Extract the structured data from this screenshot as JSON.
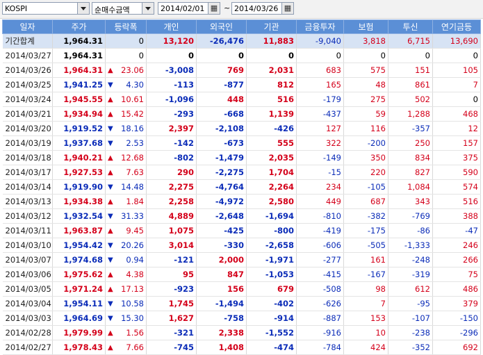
{
  "toolbar": {
    "market": "KOSPI",
    "metric": "순매수금액",
    "start_date": "2014/02/01",
    "separator": "~",
    "end_date": "2014/03/26",
    "calendar_glyph": "▦"
  },
  "columns": [
    "일자",
    "주가",
    "등락폭",
    "개인",
    "외국인",
    "기관",
    "금융투자",
    "보험",
    "투신",
    "연기금등"
  ],
  "rows": [
    {
      "date": "기간합계",
      "price": "1,964.31",
      "dir": "",
      "change": "0",
      "indiv": "13,120",
      "foreign": "-26,476",
      "inst": "11,883",
      "fin": "-9,040",
      "ins": "3,818",
      "trust": "6,715",
      "pension": "13,690",
      "total": true
    },
    {
      "date": "2014/03/27",
      "price": "1,964.31",
      "dir": "",
      "change": "0",
      "indiv": "0",
      "foreign": "0",
      "inst": "0",
      "fin": "0",
      "ins": "0",
      "trust": "0",
      "pension": "0"
    },
    {
      "date": "2014/03/26",
      "price": "1,964.31",
      "dir": "up",
      "change": "23.06",
      "indiv": "-3,008",
      "foreign": "769",
      "inst": "2,031",
      "fin": "683",
      "ins": "575",
      "trust": "151",
      "pension": "105"
    },
    {
      "date": "2014/03/25",
      "price": "1,941.25",
      "dir": "down",
      "change": "4.30",
      "indiv": "-113",
      "foreign": "-877",
      "inst": "812",
      "fin": "165",
      "ins": "48",
      "trust": "861",
      "pension": "7"
    },
    {
      "date": "2014/03/24",
      "price": "1,945.55",
      "dir": "up",
      "change": "10.61",
      "indiv": "-1,096",
      "foreign": "448",
      "inst": "516",
      "fin": "-179",
      "ins": "275",
      "trust": "502",
      "pension": "0"
    },
    {
      "date": "2014/03/21",
      "price": "1,934.94",
      "dir": "up",
      "change": "15.42",
      "indiv": "-293",
      "foreign": "-668",
      "inst": "1,139",
      "fin": "-437",
      "ins": "59",
      "trust": "1,288",
      "pension": "468"
    },
    {
      "date": "2014/03/20",
      "price": "1,919.52",
      "dir": "down",
      "change": "18.16",
      "indiv": "2,397",
      "foreign": "-2,108",
      "inst": "-426",
      "fin": "127",
      "ins": "116",
      "trust": "-357",
      "pension": "12"
    },
    {
      "date": "2014/03/19",
      "price": "1,937.68",
      "dir": "down",
      "change": "2.53",
      "indiv": "-142",
      "foreign": "-673",
      "inst": "555",
      "fin": "322",
      "ins": "-200",
      "trust": "250",
      "pension": "157"
    },
    {
      "date": "2014/03/18",
      "price": "1,940.21",
      "dir": "up",
      "change": "12.68",
      "indiv": "-802",
      "foreign": "-1,479",
      "inst": "2,035",
      "fin": "-149",
      "ins": "350",
      "trust": "834",
      "pension": "375"
    },
    {
      "date": "2014/03/17",
      "price": "1,927.53",
      "dir": "up",
      "change": "7.63",
      "indiv": "290",
      "foreign": "-2,275",
      "inst": "1,704",
      "fin": "-15",
      "ins": "220",
      "trust": "827",
      "pension": "590"
    },
    {
      "date": "2014/03/14",
      "price": "1,919.90",
      "dir": "down",
      "change": "14.48",
      "indiv": "2,275",
      "foreign": "-4,764",
      "inst": "2,264",
      "fin": "234",
      "ins": "-105",
      "trust": "1,084",
      "pension": "574"
    },
    {
      "date": "2014/03/13",
      "price": "1,934.38",
      "dir": "up",
      "change": "1.84",
      "indiv": "2,258",
      "foreign": "-4,972",
      "inst": "2,580",
      "fin": "449",
      "ins": "687",
      "trust": "343",
      "pension": "516"
    },
    {
      "date": "2014/03/12",
      "price": "1,932.54",
      "dir": "down",
      "change": "31.33",
      "indiv": "4,889",
      "foreign": "-2,648",
      "inst": "-1,694",
      "fin": "-810",
      "ins": "-382",
      "trust": "-769",
      "pension": "388"
    },
    {
      "date": "2014/03/11",
      "price": "1,963.87",
      "dir": "up",
      "change": "9.45",
      "indiv": "1,075",
      "foreign": "-425",
      "inst": "-800",
      "fin": "-419",
      "ins": "-175",
      "trust": "-86",
      "pension": "-47"
    },
    {
      "date": "2014/03/10",
      "price": "1,954.42",
      "dir": "down",
      "change": "20.26",
      "indiv": "3,014",
      "foreign": "-330",
      "inst": "-2,658",
      "fin": "-606",
      "ins": "-505",
      "trust": "-1,333",
      "pension": "246"
    },
    {
      "date": "2014/03/07",
      "price": "1,974.68",
      "dir": "down",
      "change": "0.94",
      "indiv": "-121",
      "foreign": "2,000",
      "inst": "-1,971",
      "fin": "-277",
      "ins": "161",
      "trust": "-248",
      "pension": "266"
    },
    {
      "date": "2014/03/06",
      "price": "1,975.62",
      "dir": "up",
      "change": "4.38",
      "indiv": "95",
      "foreign": "847",
      "inst": "-1,053",
      "fin": "-415",
      "ins": "-167",
      "trust": "-319",
      "pension": "75"
    },
    {
      "date": "2014/03/05",
      "price": "1,971.24",
      "dir": "up",
      "change": "17.13",
      "indiv": "-923",
      "foreign": "156",
      "inst": "679",
      "fin": "-508",
      "ins": "98",
      "trust": "612",
      "pension": "486"
    },
    {
      "date": "2014/03/04",
      "price": "1,954.11",
      "dir": "down",
      "change": "10.58",
      "indiv": "1,745",
      "foreign": "-1,494",
      "inst": "-402",
      "fin": "-626",
      "ins": "7",
      "trust": "-95",
      "pension": "379"
    },
    {
      "date": "2014/03/03",
      "price": "1,964.69",
      "dir": "down",
      "change": "15.30",
      "indiv": "1,627",
      "foreign": "-758",
      "inst": "-914",
      "fin": "-887",
      "ins": "153",
      "trust": "-107",
      "pension": "-150"
    },
    {
      "date": "2014/02/28",
      "price": "1,979.99",
      "dir": "up",
      "change": "1.56",
      "indiv": "-321",
      "foreign": "2,338",
      "inst": "-1,552",
      "fin": "-916",
      "ins": "10",
      "trust": "-238",
      "pension": "-296"
    },
    {
      "date": "2014/02/27",
      "price": "1,978.43",
      "dir": "up",
      "change": "7.66",
      "indiv": "-745",
      "foreign": "1,408",
      "inst": "-474",
      "fin": "-784",
      "ins": "424",
      "trust": "-352",
      "pension": "692"
    }
  ],
  "colors": {
    "header_bg": "#5b8fd6",
    "up": "#d4001a",
    "down": "#0b2cb8",
    "total_bg": "#d7e3f4"
  },
  "icons": {
    "up": "triangle-up-icon",
    "down": "triangle-down-icon",
    "calendar": "calendar-icon"
  }
}
